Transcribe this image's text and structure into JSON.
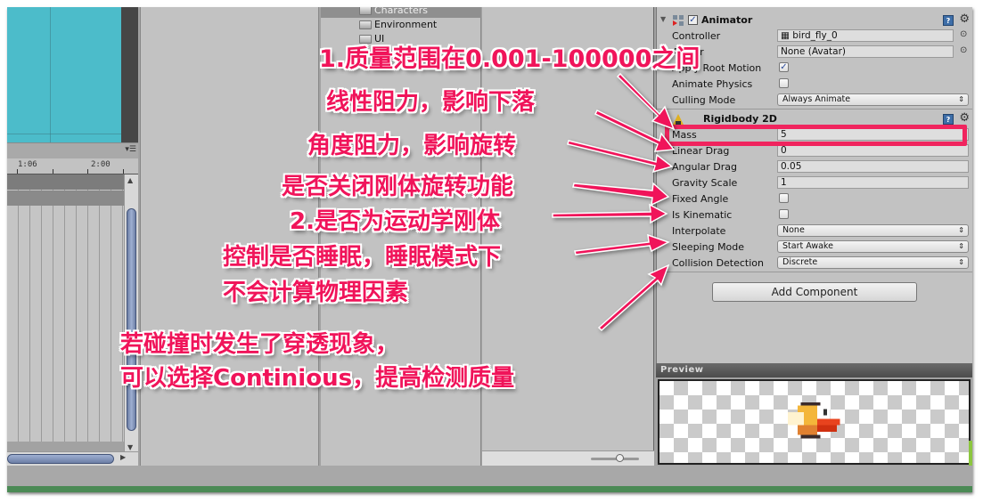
{
  "animation": {
    "timeline_labels": [
      "1:06",
      "2:00"
    ],
    "menu_icon": "panel-menu-icon"
  },
  "project": {
    "folders": [
      {
        "label": "Characters",
        "selected": true
      },
      {
        "label": "Environment",
        "selected": false
      },
      {
        "label": "UI",
        "selected": false
      }
    ]
  },
  "inspector": {
    "animator": {
      "title": "Animator",
      "enabled": true,
      "fields": {
        "controller_label": "Controller",
        "controller_value": "bird_fly_0",
        "avatar_label": "Avatar",
        "avatar_value": "None (Avatar)",
        "apply_root_motion_label": "Apply Root Motion",
        "apply_root_motion": true,
        "animate_physics_label": "Animate Physics",
        "animate_physics": false,
        "culling_mode_label": "Culling Mode",
        "culling_mode_value": "Always Animate"
      }
    },
    "rigidbody": {
      "title": "Rigidbody 2D",
      "fields": {
        "mass_label": "Mass",
        "mass_value": "5",
        "linear_drag_label": "Linear Drag",
        "linear_drag_value": "0",
        "angular_drag_label": "Angular Drag",
        "angular_drag_value": "0.05",
        "gravity_scale_label": "Gravity Scale",
        "gravity_scale_value": "1",
        "fixed_angle_label": "Fixed Angle",
        "fixed_angle": false,
        "is_kinematic_label": "Is Kinematic",
        "is_kinematic": false,
        "interpolate_label": "Interpolate",
        "interpolate_value": "None",
        "sleeping_mode_label": "Sleeping Mode",
        "sleeping_mode_value": "Start Awake",
        "collision_detection_label": "Collision Detection",
        "collision_detection_value": "Discrete"
      }
    },
    "add_component_label": "Add Component",
    "help_glyph": "?",
    "gear_glyph": "⚙",
    "picker_glyph": "⊙",
    "dropdown_glyph": "⇕",
    "check_glyph": "✓"
  },
  "preview": {
    "title": "Preview"
  },
  "annotations": {
    "mass": "1.质量范围在0.001-100000之间",
    "linear_drag": "线性阻力，影响下落",
    "angular_drag": "角度阻力，影响旋转",
    "fixed_angle": "是否关闭刚体旋转功能",
    "is_kinematic": "2.是否为运动学刚体",
    "sleeping_line1": "控制是否睡眠，睡眠模式下",
    "sleeping_line2": "不会计算物理因素",
    "collision_line1": "若碰撞时发生了穿透现象，",
    "collision_line2": "可以选择Continious，提高检测质量"
  },
  "colors": {
    "annotation": "#f0145a",
    "scene_bg": "#4cbcca",
    "editor_bg": "#c2c2c2"
  }
}
